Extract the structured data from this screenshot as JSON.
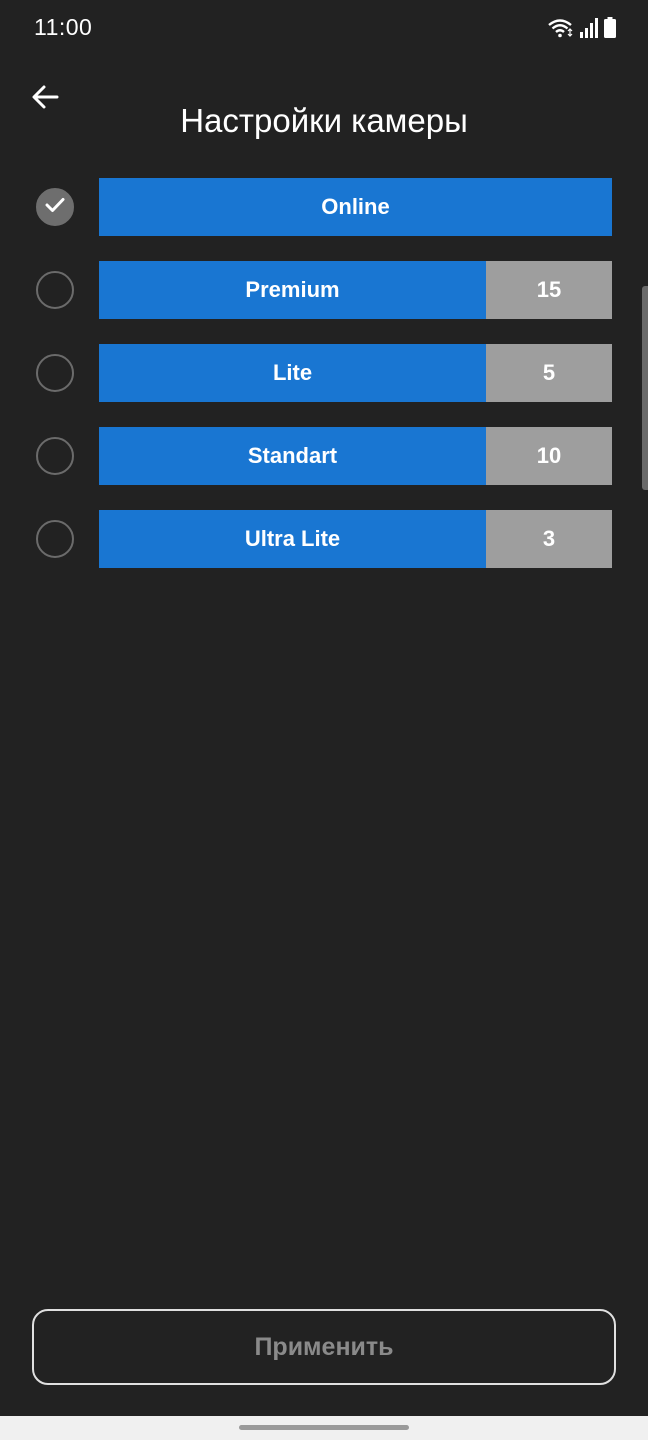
{
  "status_bar": {
    "time": "11:00",
    "icons": [
      "wifi-icon",
      "signal-icon",
      "battery-icon"
    ]
  },
  "app_bar": {
    "back_icon": "arrow-left-icon",
    "title": "Настройки камеры"
  },
  "plans": [
    {
      "name": "Online",
      "count": "",
      "selected": true
    },
    {
      "name": "Premium",
      "count": "15",
      "selected": false
    },
    {
      "name": "Lite",
      "count": "5",
      "selected": false
    },
    {
      "name": "Standart",
      "count": "10",
      "selected": false
    },
    {
      "name": "Ultra Lite",
      "count": "3",
      "selected": false
    }
  ],
  "apply_button": {
    "label": "Применить"
  },
  "colors": {
    "background": "#222222",
    "plan_blue": "#1976d2",
    "count_gray": "#9e9e9e",
    "apply_text": "#8a8a8a"
  }
}
